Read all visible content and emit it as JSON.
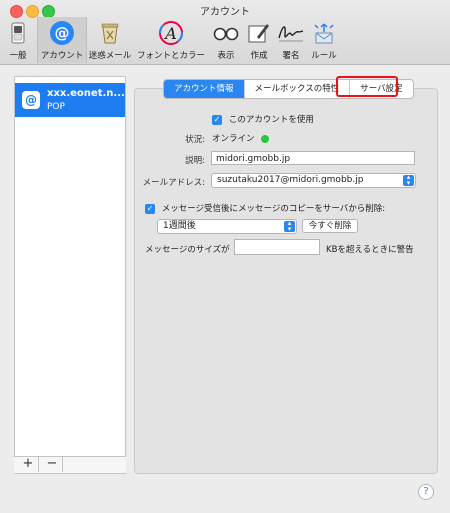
{
  "window": {
    "title": "アカウント"
  },
  "toolbar": {
    "items": [
      {
        "label": "一般",
        "icon": "switch-icon"
      },
      {
        "label": "アカウント",
        "icon": "at-icon",
        "selected": true
      },
      {
        "label": "迷惑メール",
        "icon": "junk-trash-icon"
      },
      {
        "label": "フォントとカラー",
        "icon": "font-color-icon"
      },
      {
        "label": "表示",
        "icon": "glasses-icon"
      },
      {
        "label": "作成",
        "icon": "compose-icon"
      },
      {
        "label": "署名",
        "icon": "signature-icon"
      },
      {
        "label": "ルール",
        "icon": "rules-icon"
      }
    ]
  },
  "sidebar": {
    "account": {
      "icon_glyph": "@",
      "name": "xxx.eonet.n...",
      "type": "POP"
    },
    "add_label": "+",
    "remove_label": "−"
  },
  "tabs": [
    {
      "label": "アカウント情報",
      "active": true
    },
    {
      "label": "メールボックスの特性",
      "active": false
    },
    {
      "label": "サーバ設定",
      "active": false
    }
  ],
  "form": {
    "enable_label": "このアカウントを使用",
    "status_label": "状況:",
    "status_value": "オンライン",
    "description_label": "説明:",
    "description_value": "midori.gmobb.jp",
    "email_label": "メールアドレス:",
    "email_value": "suzutaku2017@midori.gmobb.jp",
    "remove_copy_label": "メッセージ受信後にメッセージのコピーをサーバから削除:",
    "remove_after_value": "1週間後",
    "remove_now_label": "今すぐ削除",
    "size_prefix": "メッセージのサイズが",
    "size_value": "",
    "size_suffix": "KBを超えるときに警告"
  },
  "help_label": "?",
  "colors": {
    "accent": "#2a86f0",
    "selection": "#1f7df2",
    "highlight": "#e8141a",
    "status_online": "#29c540"
  }
}
